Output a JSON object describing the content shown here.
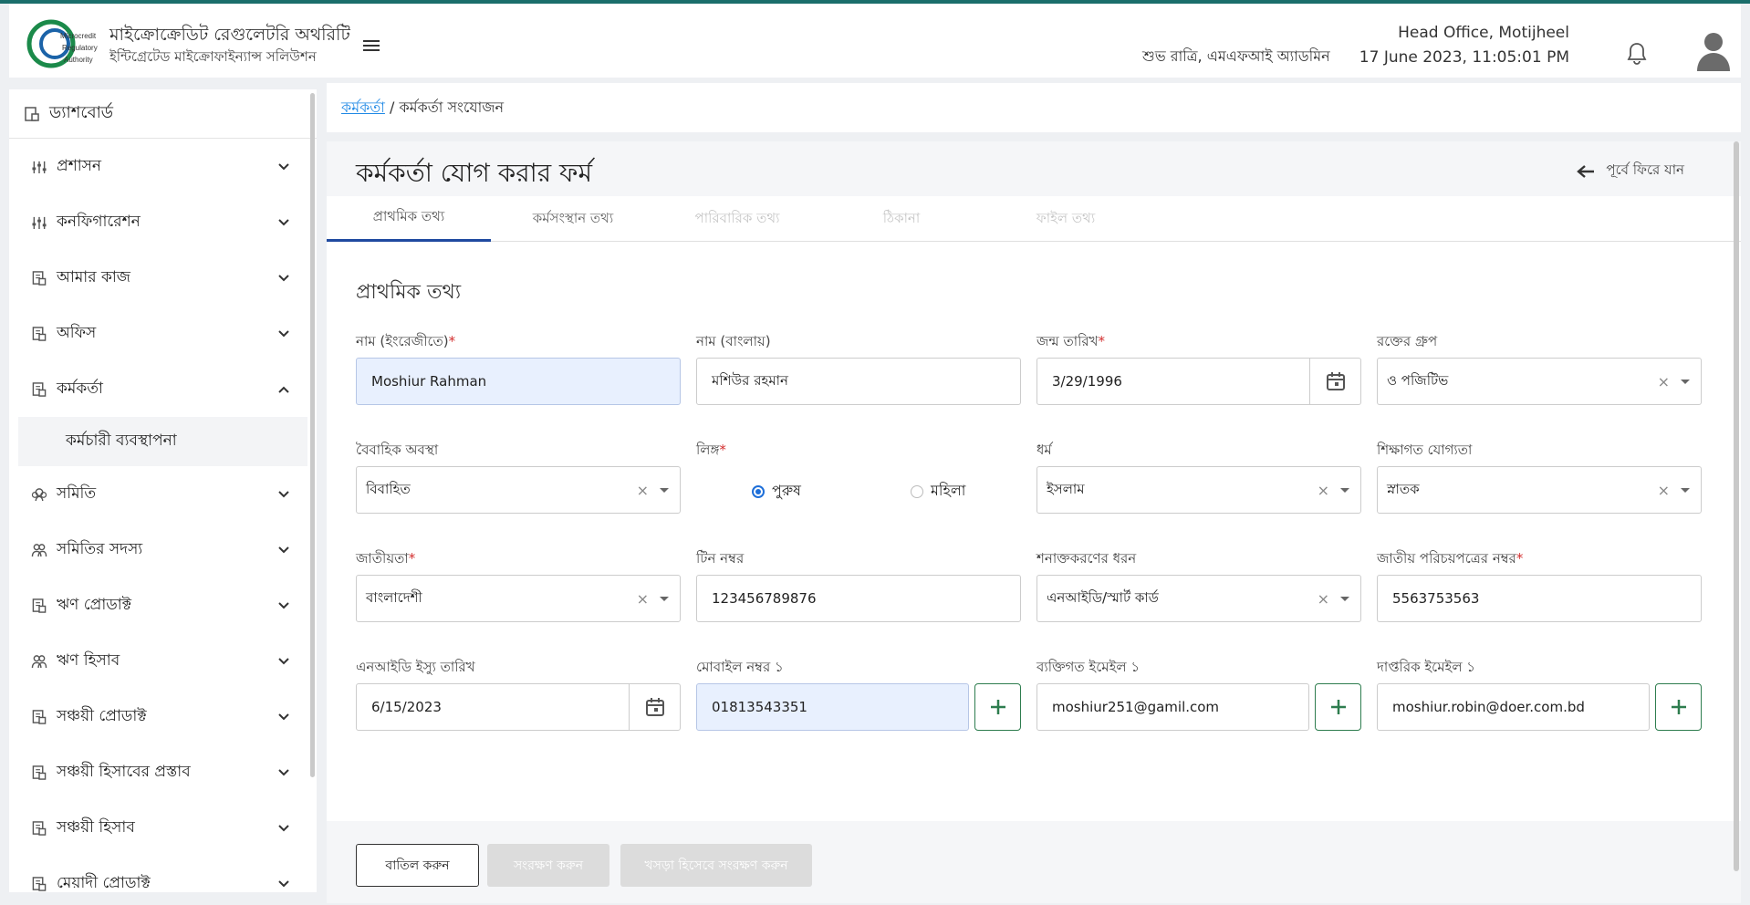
{
  "header": {
    "brand_title": "মাইক্রোক্রেডিট রেগুলেটরি অথরিটি",
    "brand_subtitle": "ইন্টিগ্রেটেড মাইক্রোফাইন্যান্স সলিউশন",
    "logo_text": [
      "Microcredit",
      "Regulatory",
      "Authority"
    ],
    "greeting": "শুভ রাত্রি, এমএফআই অ্যাডমিন",
    "office": "Head Office, Motijheel",
    "datetime": "17 June 2023, 11:05:01 PM"
  },
  "sidebar": {
    "dashboard": "ড্যাশবোর্ড",
    "items": [
      {
        "label": "প্রশাসন",
        "icon": "sliders-icon",
        "expanded": false
      },
      {
        "label": "কনফিগারেশন",
        "icon": "sliders-icon",
        "expanded": false
      },
      {
        "label": "আমার কাজ",
        "icon": "document-icon",
        "expanded": false
      },
      {
        "label": "অফিস",
        "icon": "document-icon",
        "expanded": false
      },
      {
        "label": "কর্মকর্তা",
        "icon": "document-icon",
        "expanded": true
      },
      {
        "label": "সমিতি",
        "icon": "group-icon",
        "expanded": false
      },
      {
        "label": "সমিতির সদস্য",
        "icon": "users-icon",
        "expanded": false
      },
      {
        "label": "ঋণ প্রোডাক্ট",
        "icon": "document-icon",
        "expanded": false
      },
      {
        "label": "ঋণ হিসাব",
        "icon": "users-icon",
        "expanded": false
      },
      {
        "label": "সঞ্চয়ী প্রোডাক্ট",
        "icon": "document-icon",
        "expanded": false
      },
      {
        "label": "সঞ্চয়ী হিসাবের প্রস্তাব",
        "icon": "document-icon",
        "expanded": false
      },
      {
        "label": "সঞ্চয়ী হিসাব",
        "icon": "document-icon",
        "expanded": false
      },
      {
        "label": "মেয়াদী প্রোডাক্ট",
        "icon": "document-icon",
        "expanded": false
      }
    ],
    "subitem": "কর্মচারী ব্যবস্থাপনা"
  },
  "breadcrumb": {
    "link": "কর্মকর্তা",
    "separator": " / ",
    "current": "কর্মকর্তা সংযোজন"
  },
  "form": {
    "title": "কর্মকর্তা যোগ করার ফর্ম",
    "back_label": "পূর্বে ফিরে যান",
    "tabs": [
      "প্রাথমিক তথ্য",
      "কর্মসংস্থান তথ্য",
      "পারিবারিক তথ্য",
      "ঠিকানা",
      "ফাইল তথ্য"
    ],
    "section_title": "প্রাথমিক তথ্য",
    "fields": {
      "name_en": {
        "label": "নাম (ইংরেজীতে)",
        "value": "Moshiur Rahman"
      },
      "name_bn": {
        "label": "নাম (বাংলায়)",
        "value": "মশিউর রহমান"
      },
      "dob": {
        "label": "জন্ম তারিখ",
        "value": "3/29/1996"
      },
      "blood_group": {
        "label": "রক্তের গ্রুপ",
        "value": "ও পজিটিভ"
      },
      "marital": {
        "label": "বৈবাহিক অবস্থা",
        "value": "বিবাহিত"
      },
      "gender": {
        "label": "লিঙ্গ",
        "options": [
          "পুরুষ",
          "মহিলা"
        ],
        "selected": "পুরুষ"
      },
      "religion": {
        "label": "ধর্ম",
        "value": "ইসলাম"
      },
      "education": {
        "label": "শিক্ষাগত যোগ্যতা",
        "value": "স্নাতক"
      },
      "nationality": {
        "label": "জাতীয়তা",
        "value": "বাংলাদেশী"
      },
      "tin": {
        "label": "টিন নম্বর",
        "value": "123456789876"
      },
      "id_type": {
        "label": "শনাক্তকরণের ধরন",
        "value": "এনআইডি/স্মার্ট কার্ড"
      },
      "nid": {
        "label": "জাতীয় পরিচয়পত্রের নম্বর",
        "value": "5563753563"
      },
      "nid_issue": {
        "label": "এনআইডি ইস্যু তারিখ",
        "value": "6/15/2023"
      },
      "mobile": {
        "label": "মোবাইল নম্বর ১",
        "value": "01813543351"
      },
      "personal_email": {
        "label": "ব্যক্তিগত ইমেইল ১",
        "value": "moshiur251@gamil.com"
      },
      "office_email": {
        "label": "দাপ্তরিক ইমেইল ১",
        "value": "moshiur.robin@doer.com.bd"
      }
    },
    "buttons": {
      "cancel": "বাতিল করুন",
      "save": "সংরক্ষণ করুন",
      "draft": "খসড়া হিসেবে সংরক্ষণ করুন"
    }
  },
  "colors": {
    "accent": "#1f4aa0",
    "plus_green": "#2e7d4f",
    "required": "#d32f2f",
    "top_line": "#1b6e6b"
  }
}
